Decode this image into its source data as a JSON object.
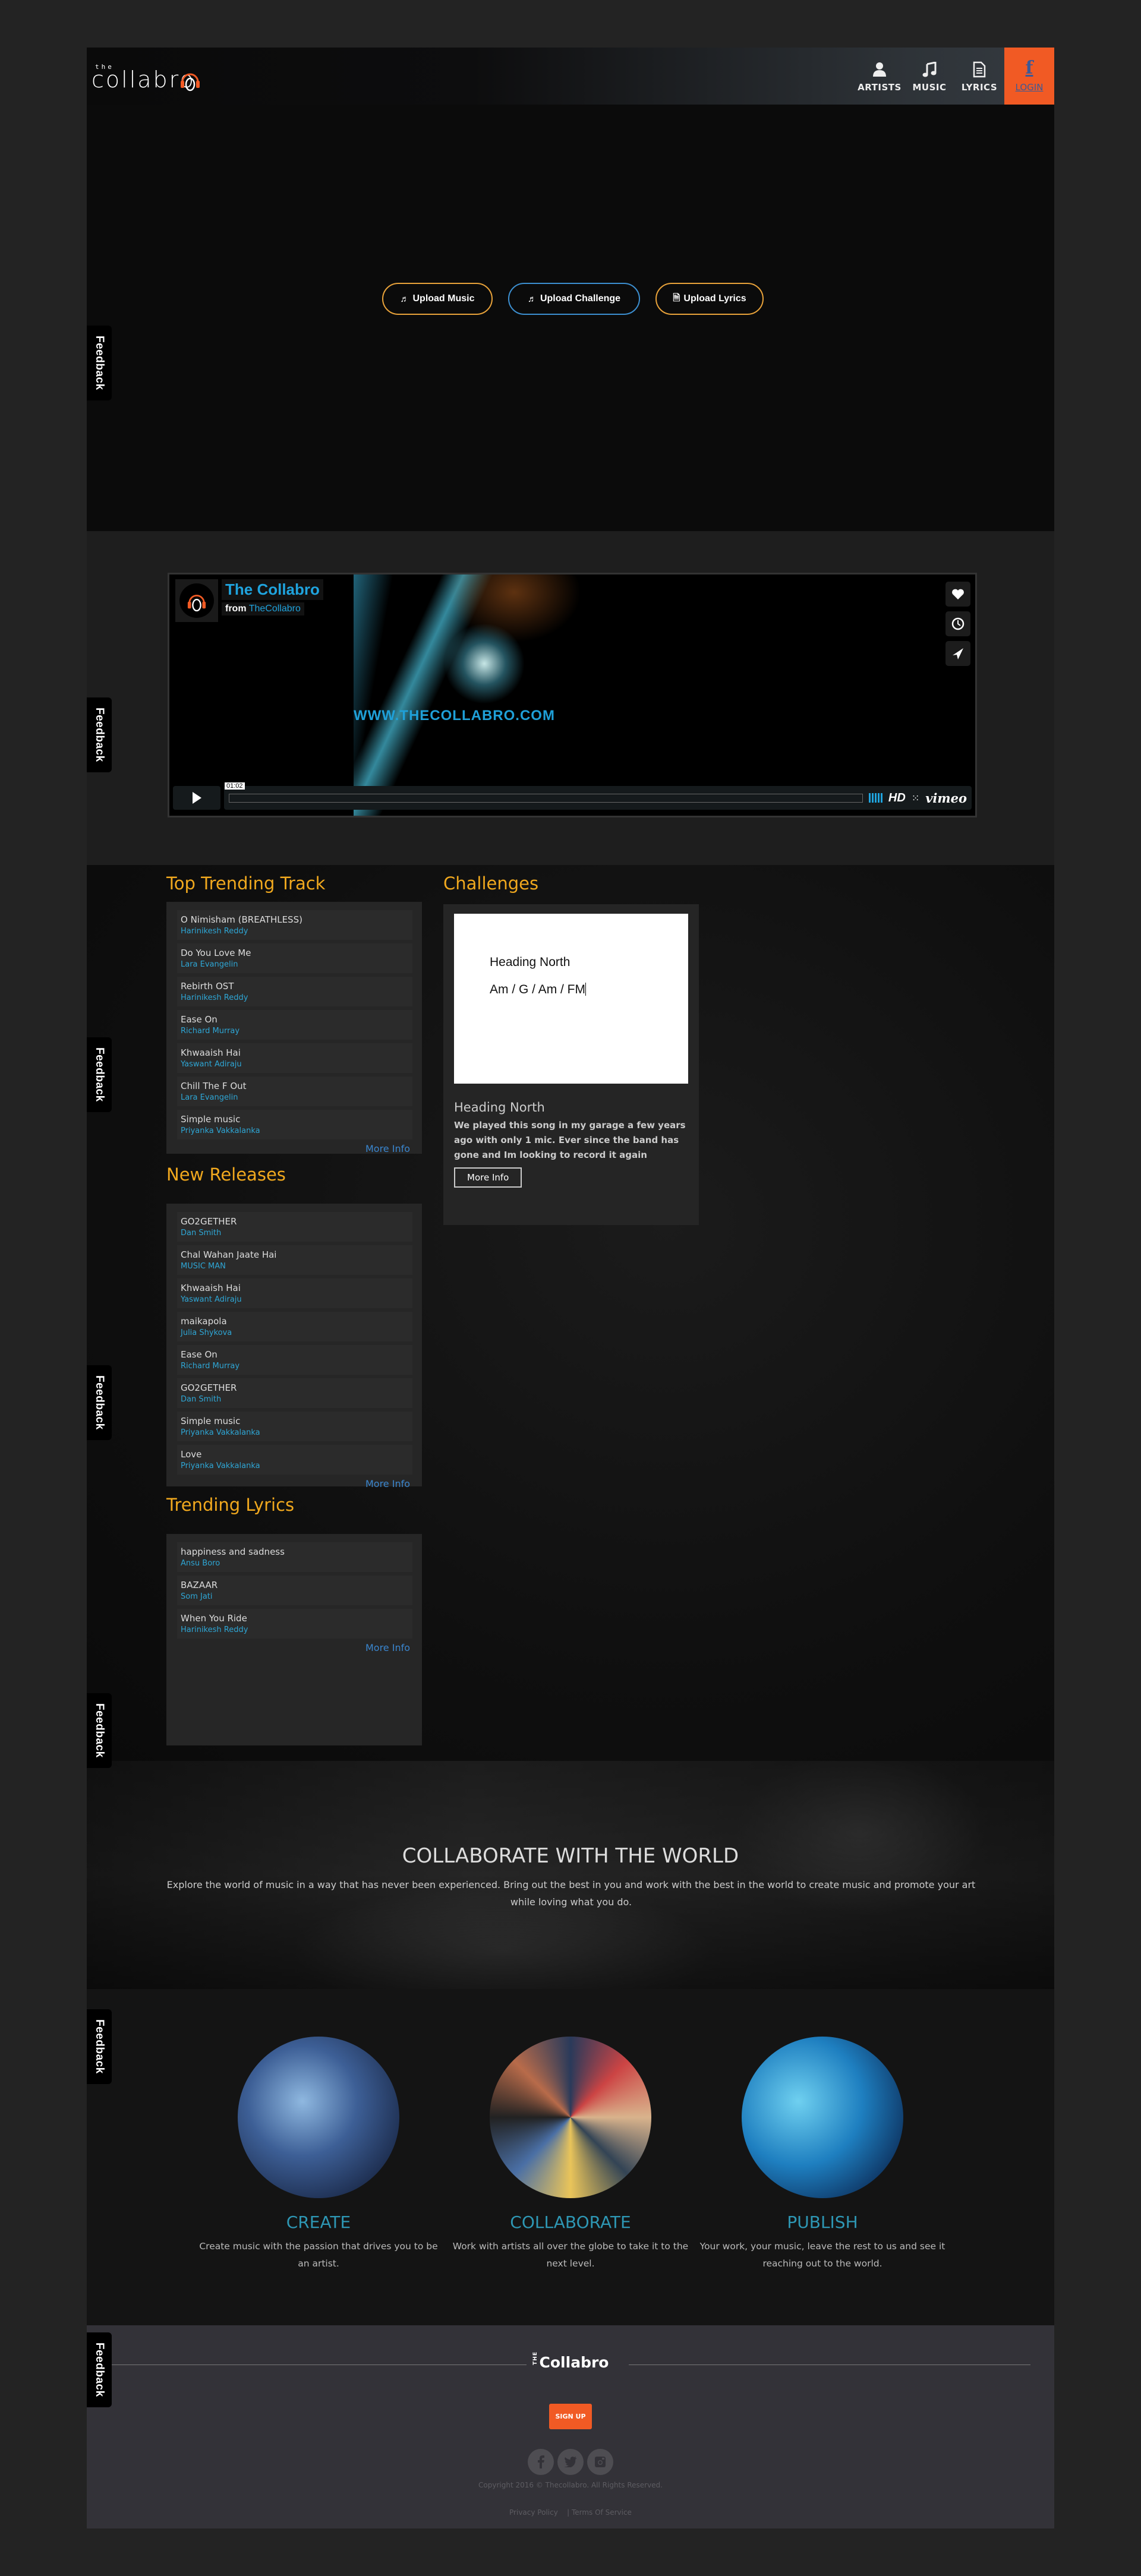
{
  "header": {
    "logo_small": "the",
    "logo_word": "collabro",
    "nav": [
      {
        "label": "ARTISTS",
        "icon": "user-icon"
      },
      {
        "label": "MUSIC",
        "icon": "music-note-icon"
      },
      {
        "label": "LYRICS",
        "icon": "document-icon"
      }
    ],
    "login": {
      "label": "LOGIN",
      "icon": "facebook-icon"
    }
  },
  "hero": {
    "buttons": [
      {
        "label": "Upload Music",
        "icon": "music-note-icon",
        "color": "#e8a23a"
      },
      {
        "label": "Upload Challenge",
        "icon": "music-note-icon",
        "color": "#3c8fd0"
      },
      {
        "label": "Upload Lyrics",
        "icon": "document-icon",
        "color": "#e8a23a"
      }
    ]
  },
  "feedback_label": "Feedback",
  "video": {
    "title": "The Collabro",
    "from_label": "from",
    "channel": "TheCollabro",
    "overlay_text": "WWW.THECOLLABRO.COM",
    "time": "01:02",
    "hd_label": "HD",
    "brand": "vimeo"
  },
  "top_trending": {
    "title": "Top Trending Track",
    "items": [
      {
        "title": "O Nimisham (BREATHLESS)",
        "artist": "Harinikesh Reddy"
      },
      {
        "title": "Do You Love Me",
        "artist": "Lara Evangelin"
      },
      {
        "title": "Rebirth OST",
        "artist": "Harinikesh Reddy"
      },
      {
        "title": "Ease On",
        "artist": "Richard Murray"
      },
      {
        "title": "Khwaaish Hai",
        "artist": "Yaswant Adiraju"
      },
      {
        "title": "Chill The F Out",
        "artist": "Lara Evangelin"
      },
      {
        "title": "Simple music",
        "artist": "Priyanka Vakkalanka"
      }
    ],
    "more": "More Info"
  },
  "new_releases": {
    "title": "New Releases",
    "items": [
      {
        "title": "GO2GETHER",
        "artist": "Dan Smith"
      },
      {
        "title": "Chal Wahan Jaate Hai",
        "artist": "MUSIC MAN"
      },
      {
        "title": "Khwaaish Hai",
        "artist": "Yaswant Adiraju"
      },
      {
        "title": "maikapola",
        "artist": "Julia Shykova"
      },
      {
        "title": "Ease On",
        "artist": "Richard Murray"
      },
      {
        "title": "GO2GETHER",
        "artist": "Dan Smith"
      },
      {
        "title": "Simple music",
        "artist": "Priyanka Vakkalanka"
      },
      {
        "title": "Love",
        "artist": "Priyanka Vakkalanka"
      }
    ],
    "more": "More Info"
  },
  "trending_lyrics": {
    "title": "Trending Lyrics",
    "items": [
      {
        "title": "happiness and sadness",
        "artist": "Ansu Boro"
      },
      {
        "title": "BAZAAR",
        "artist": "Som Jati"
      },
      {
        "title": "When You Ride",
        "artist": "Harinikesh Reddy"
      }
    ],
    "more": "More Info"
  },
  "challenges": {
    "title": "Challenges",
    "card": {
      "image_heading": "Heading North",
      "image_chords": "Am / G / Am / FM",
      "name": "Heading North",
      "description": "We played this song in my garage a few years ago with only 1 mic. Ever since the band has gone and Im looking to record it again",
      "button": "More Info"
    }
  },
  "banner": {
    "title": "COLLABORATE WITH THE WORLD",
    "text": "Explore the world of music in a way that has never been experienced. Bring out the best in you and work with the best in the world to create music and promote your art while loving what you do."
  },
  "features": [
    {
      "title": "CREATE",
      "text": "Create music with the passion that drives you to be an artist."
    },
    {
      "title": "COLLABORATE",
      "text": "Work with artists all over the globe to take it to the next level."
    },
    {
      "title": "PUBLISH",
      "text": "Your work, your music, leave the rest to us and see it reaching out to the world."
    }
  ],
  "footer": {
    "logo_small": "THE",
    "logo_word": "Collabro",
    "signup": "SIGN UP",
    "socials": [
      "facebook-icon",
      "twitter-icon",
      "instagram-icon"
    ],
    "copyright": "Copyright 2016 © Thecollabro. All Rights Reserved.",
    "privacy": "Privacy Policy",
    "separator": "|",
    "terms": "Terms Of Service"
  },
  "colors": {
    "accent_orange": "#f15a24",
    "section_title": "#f0a81e",
    "link_blue": "#2ea6d5",
    "feature_title": "#2e97b4"
  }
}
